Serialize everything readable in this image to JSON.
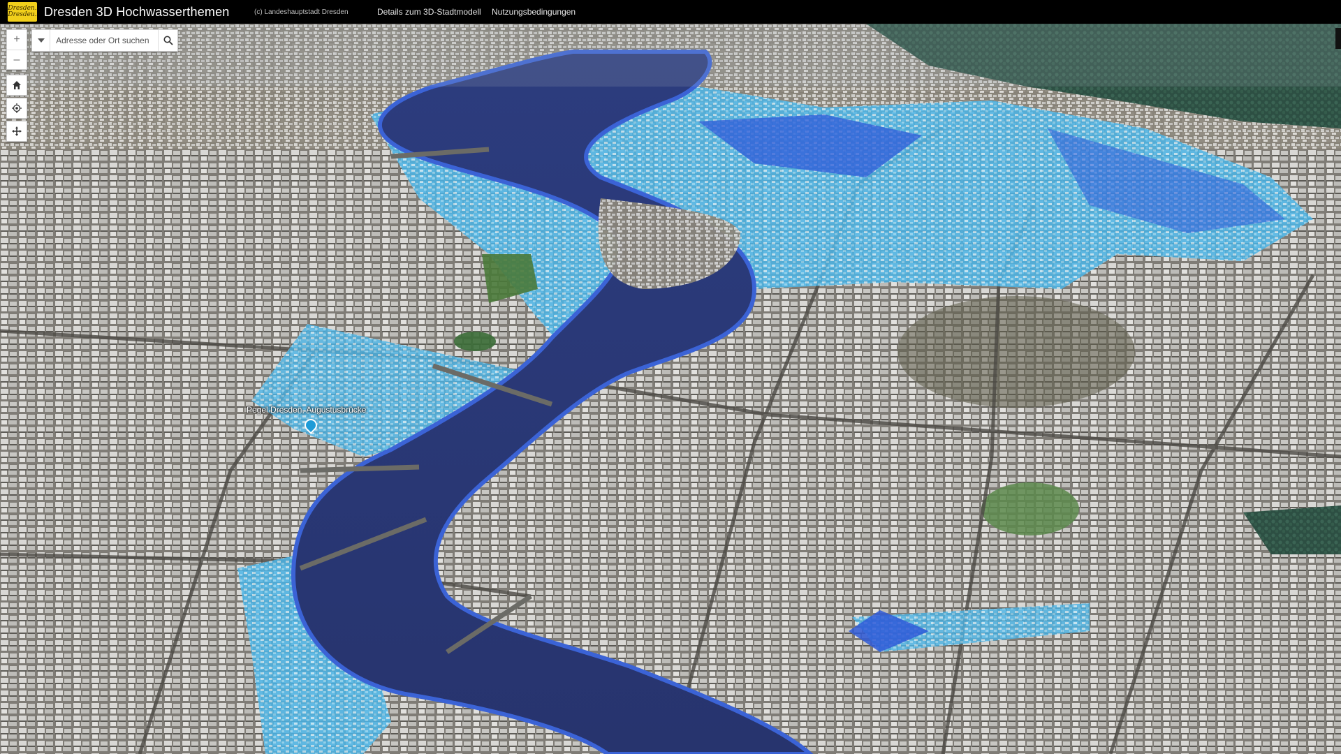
{
  "header": {
    "logo_text": "Dresden.",
    "logo_subtext": "Dresdeu.",
    "title": "Dresden 3D Hochwasserthemen",
    "copyright": "(c) Landeshauptstadt Dresden",
    "nav": {
      "details": "Details zum 3D-Stadtmodell",
      "terms": "Nutzungsbedingungen"
    }
  },
  "controls": {
    "zoom_in": "+",
    "zoom_out": "–",
    "home_icon": "home-icon",
    "locate_icon": "locate-icon",
    "navigation_icon": "pan-icon"
  },
  "search": {
    "placeholder": "Adresse oder Ort suchen",
    "source_icon": "chevron-down-icon",
    "button_icon": "search-icon"
  },
  "map": {
    "gauge_label": "Pegel Dresden, Augustusbrücke",
    "colors": {
      "river": "#2a3a7a",
      "flood_deep": "#2f5bd8",
      "flood_shallow": "#49b3e8",
      "city": "#8d8a84",
      "forest": "#2e5446"
    }
  }
}
